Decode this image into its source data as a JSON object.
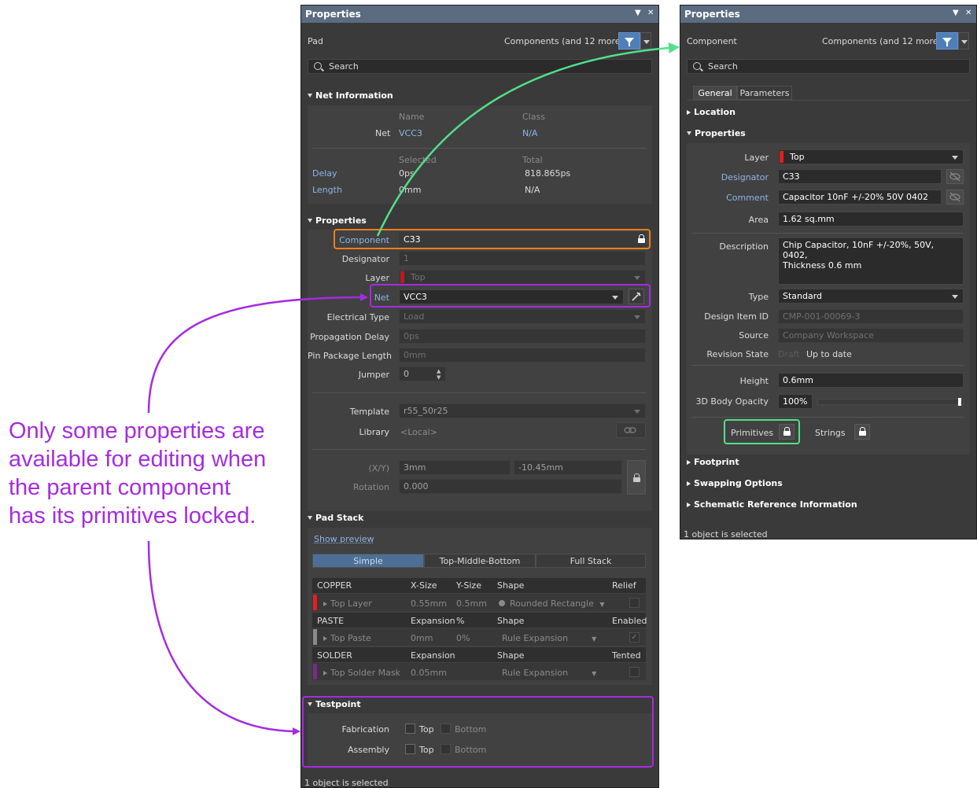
{
  "annotation": {
    "lines": [
      "Only some properties are",
      "available for editing when",
      "the parent component",
      "has its primitives locked."
    ]
  },
  "left_panel": {
    "title": "Properties",
    "object_type": "Pad",
    "filter_text": "Components (and 12 more)",
    "search_placeholder": "Search",
    "net_info": {
      "header": "Net Information",
      "col_name": "Name",
      "col_class": "Class",
      "net_label": "Net",
      "net_value": "VCC3",
      "class_value": "N/A",
      "col_selected": "Selected",
      "col_total": "Total",
      "delay_label": "Delay",
      "delay_selected": "0ps",
      "delay_total": "818.865ps",
      "length_label": "Length",
      "length_selected": "0mm",
      "length_total": "N/A"
    },
    "properties": {
      "header": "Properties",
      "component_label": "Component",
      "component_value": "C33",
      "designator_label": "Designator",
      "designator_value": "1",
      "layer_label": "Layer",
      "layer_value": "Top",
      "net_label": "Net",
      "net_value": "VCC3",
      "electrical_type_label": "Electrical Type",
      "electrical_type_value": "Load",
      "propagation_delay_label": "Propagation Delay",
      "propagation_delay_value": "0ps",
      "pin_package_length_label": "Pin Package Length",
      "pin_package_length_value": "0mm",
      "jumper_label": "Jumper",
      "jumper_value": "0",
      "template_label": "Template",
      "template_value": "r55_50r25",
      "library_label": "Library",
      "library_value": "<Local>",
      "xy_label": "(X/Y)",
      "x_value": "3mm",
      "y_value": "-10.45mm",
      "rotation_label": "Rotation",
      "rotation_value": "0.000"
    },
    "pad_stack": {
      "header": "Pad Stack",
      "show_preview": "Show preview",
      "tabs": [
        "Simple",
        "Top-Middle-Bottom",
        "Full Stack"
      ],
      "copper": {
        "c1": "COPPER",
        "c2": "X-Size",
        "c3": "Y-Size",
        "c4": "Shape",
        "c5": "Relief",
        "row_name": "Top Layer",
        "x": "0.55mm",
        "y": "0.5mm",
        "shape": "Rounded Rectangle"
      },
      "paste": {
        "c1": "PASTE",
        "c2": "Expansion",
        "c3": "%",
        "c4": "Shape",
        "c5": "Enabled",
        "row_name": "Top Paste",
        "x": "0mm",
        "y": "0%",
        "shape": "Rule Expansion"
      },
      "solder": {
        "c1": "SOLDER",
        "c2": "Expansion",
        "c4": "Shape",
        "c5": "Tented",
        "row_name": "Top Solder Mask",
        "x": "0.05mm",
        "shape": "Rule Expansion"
      }
    },
    "testpoint": {
      "header": "Testpoint",
      "fabrication_label": "Fabrication",
      "assembly_label": "Assembly",
      "top": "Top",
      "bottom": "Bottom"
    },
    "status": "1 object is selected"
  },
  "right_panel": {
    "title": "Properties",
    "object_type": "Component",
    "filter_text": "Components (and 12 more)",
    "search_placeholder": "Search",
    "tabs": [
      "General",
      "Parameters"
    ],
    "location_header": "Location",
    "properties_header": "Properties",
    "layer_label": "Layer",
    "layer_value": "Top",
    "designator_label": "Designator",
    "designator_value": "C33",
    "comment_label": "Comment",
    "comment_value": "Capacitor 10nF +/-20% 50V 0402",
    "area_label": "Area",
    "area_value": "1.62 sq.mm",
    "description_label": "Description",
    "description_line1": "Chip Capacitor, 10nF +/-20%, 50V, 0402,",
    "description_line2": "Thickness 0.6 mm",
    "type_label": "Type",
    "type_value": "Standard",
    "design_item_label": "Design Item ID",
    "design_item_value": "CMP-001-00069-3",
    "source_label": "Source",
    "source_value": "Company Workspace",
    "revision_label": "Revision State",
    "revision_draft": "Draft",
    "revision_value": "Up to date",
    "height_label": "Height",
    "height_value": "0.6mm",
    "opacity_label": "3D Body Opacity",
    "opacity_value": "100%",
    "opacity_level": 1.0,
    "primitives_label": "Primitives",
    "strings_label": "Strings",
    "footprint_header": "Footprint",
    "swapping_header": "Swapping Options",
    "schematic_header": "Schematic Reference Information",
    "status": "1 object is selected"
  },
  "colors": {
    "orange_highlight": "#f07d1a",
    "purple_highlight": "#a52ce0",
    "green_highlight": "#52e08a",
    "title_bar": "#5b6b80"
  }
}
